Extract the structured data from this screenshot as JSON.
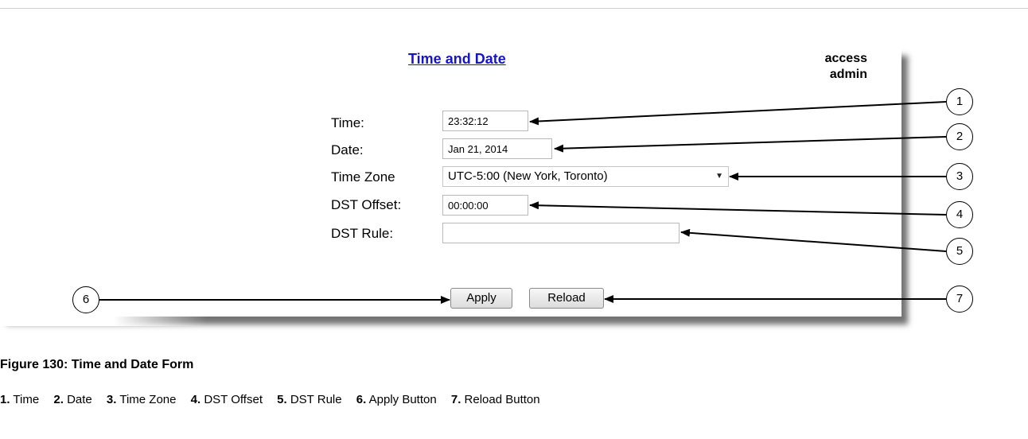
{
  "form": {
    "title": "Time and Date",
    "access_line1": "access",
    "access_line2": "admin",
    "time_label": "Time:",
    "time_value": "23:32:12",
    "date_label": "Date:",
    "date_value": "Jan 21, 2014",
    "timezone_label": "Time Zone",
    "timezone_value": "UTC-5:00 (New York, Toronto)",
    "dst_offset_label": "DST Offset:",
    "dst_offset_value": "00:00:00",
    "dst_rule_label": "DST Rule:",
    "dst_rule_value": "",
    "apply_label": "Apply",
    "reload_label": "Reload"
  },
  "callouts": [
    "1",
    "2",
    "3",
    "4",
    "5",
    "6",
    "7"
  ],
  "figure": {
    "title": "Figure 130: Time and Date Form",
    "legend": [
      {
        "num": "1.",
        "text": "Time"
      },
      {
        "num": "2.",
        "text": "Date"
      },
      {
        "num": "3.",
        "text": "Time Zone"
      },
      {
        "num": "4.",
        "text": "DST Offset"
      },
      {
        "num": "5.",
        "text": "DST Rule"
      },
      {
        "num": "6.",
        "text": "Apply Button"
      },
      {
        "num": "7.",
        "text": "Reload Button"
      }
    ]
  }
}
